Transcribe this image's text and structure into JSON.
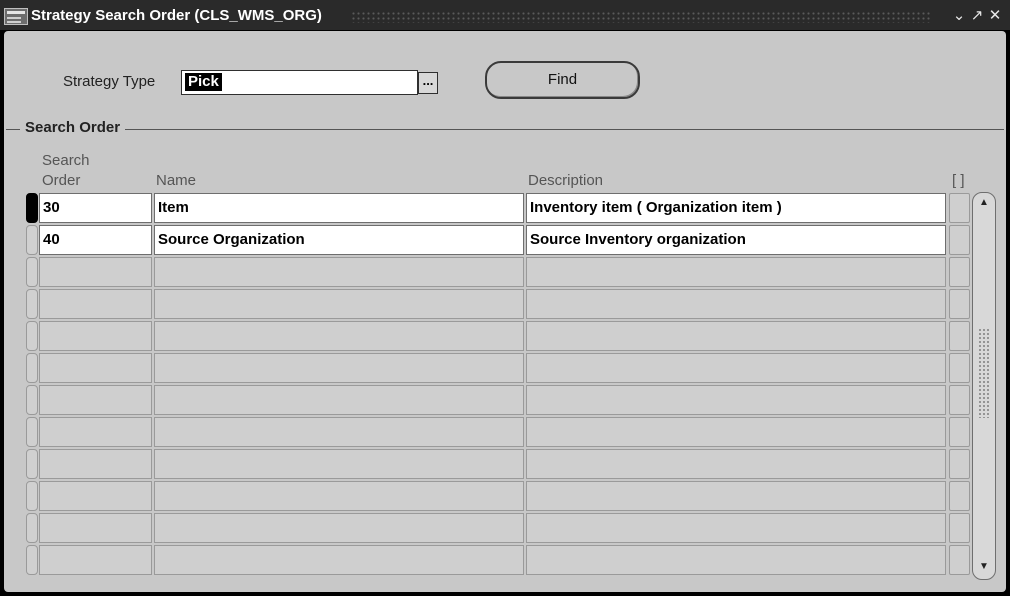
{
  "window": {
    "title": "Strategy Search Order (CLS_WMS_ORG)",
    "controls": [
      "minimize-icon",
      "maximize-icon",
      "close-icon"
    ]
  },
  "form": {
    "strategy_type_label": "Strategy Type",
    "strategy_type_value": "Pick",
    "lov_glyph": "...",
    "find_label": "Find"
  },
  "group": {
    "title": "Search Order",
    "columns": {
      "search_order_line1": "Search",
      "search_order_line2": "Order",
      "name": "Name",
      "description": "Description",
      "flex": "[ ]"
    },
    "rows": [
      {
        "order": "30",
        "name": "Item",
        "description": "Inventory item ( Organization item )"
      },
      {
        "order": "40",
        "name": "Source Organization",
        "description": "Source Inventory organization"
      },
      {
        "order": "",
        "name": "",
        "description": ""
      },
      {
        "order": "",
        "name": "",
        "description": ""
      },
      {
        "order": "",
        "name": "",
        "description": ""
      },
      {
        "order": "",
        "name": "",
        "description": ""
      },
      {
        "order": "",
        "name": "",
        "description": ""
      },
      {
        "order": "",
        "name": "",
        "description": ""
      },
      {
        "order": "",
        "name": "",
        "description": ""
      },
      {
        "order": "",
        "name": "",
        "description": ""
      },
      {
        "order": "",
        "name": "",
        "description": ""
      },
      {
        "order": "",
        "name": "",
        "description": ""
      }
    ]
  },
  "scrollbar": {
    "up_icon": "arrow-up-icon",
    "down_icon": "arrow-down-icon"
  }
}
